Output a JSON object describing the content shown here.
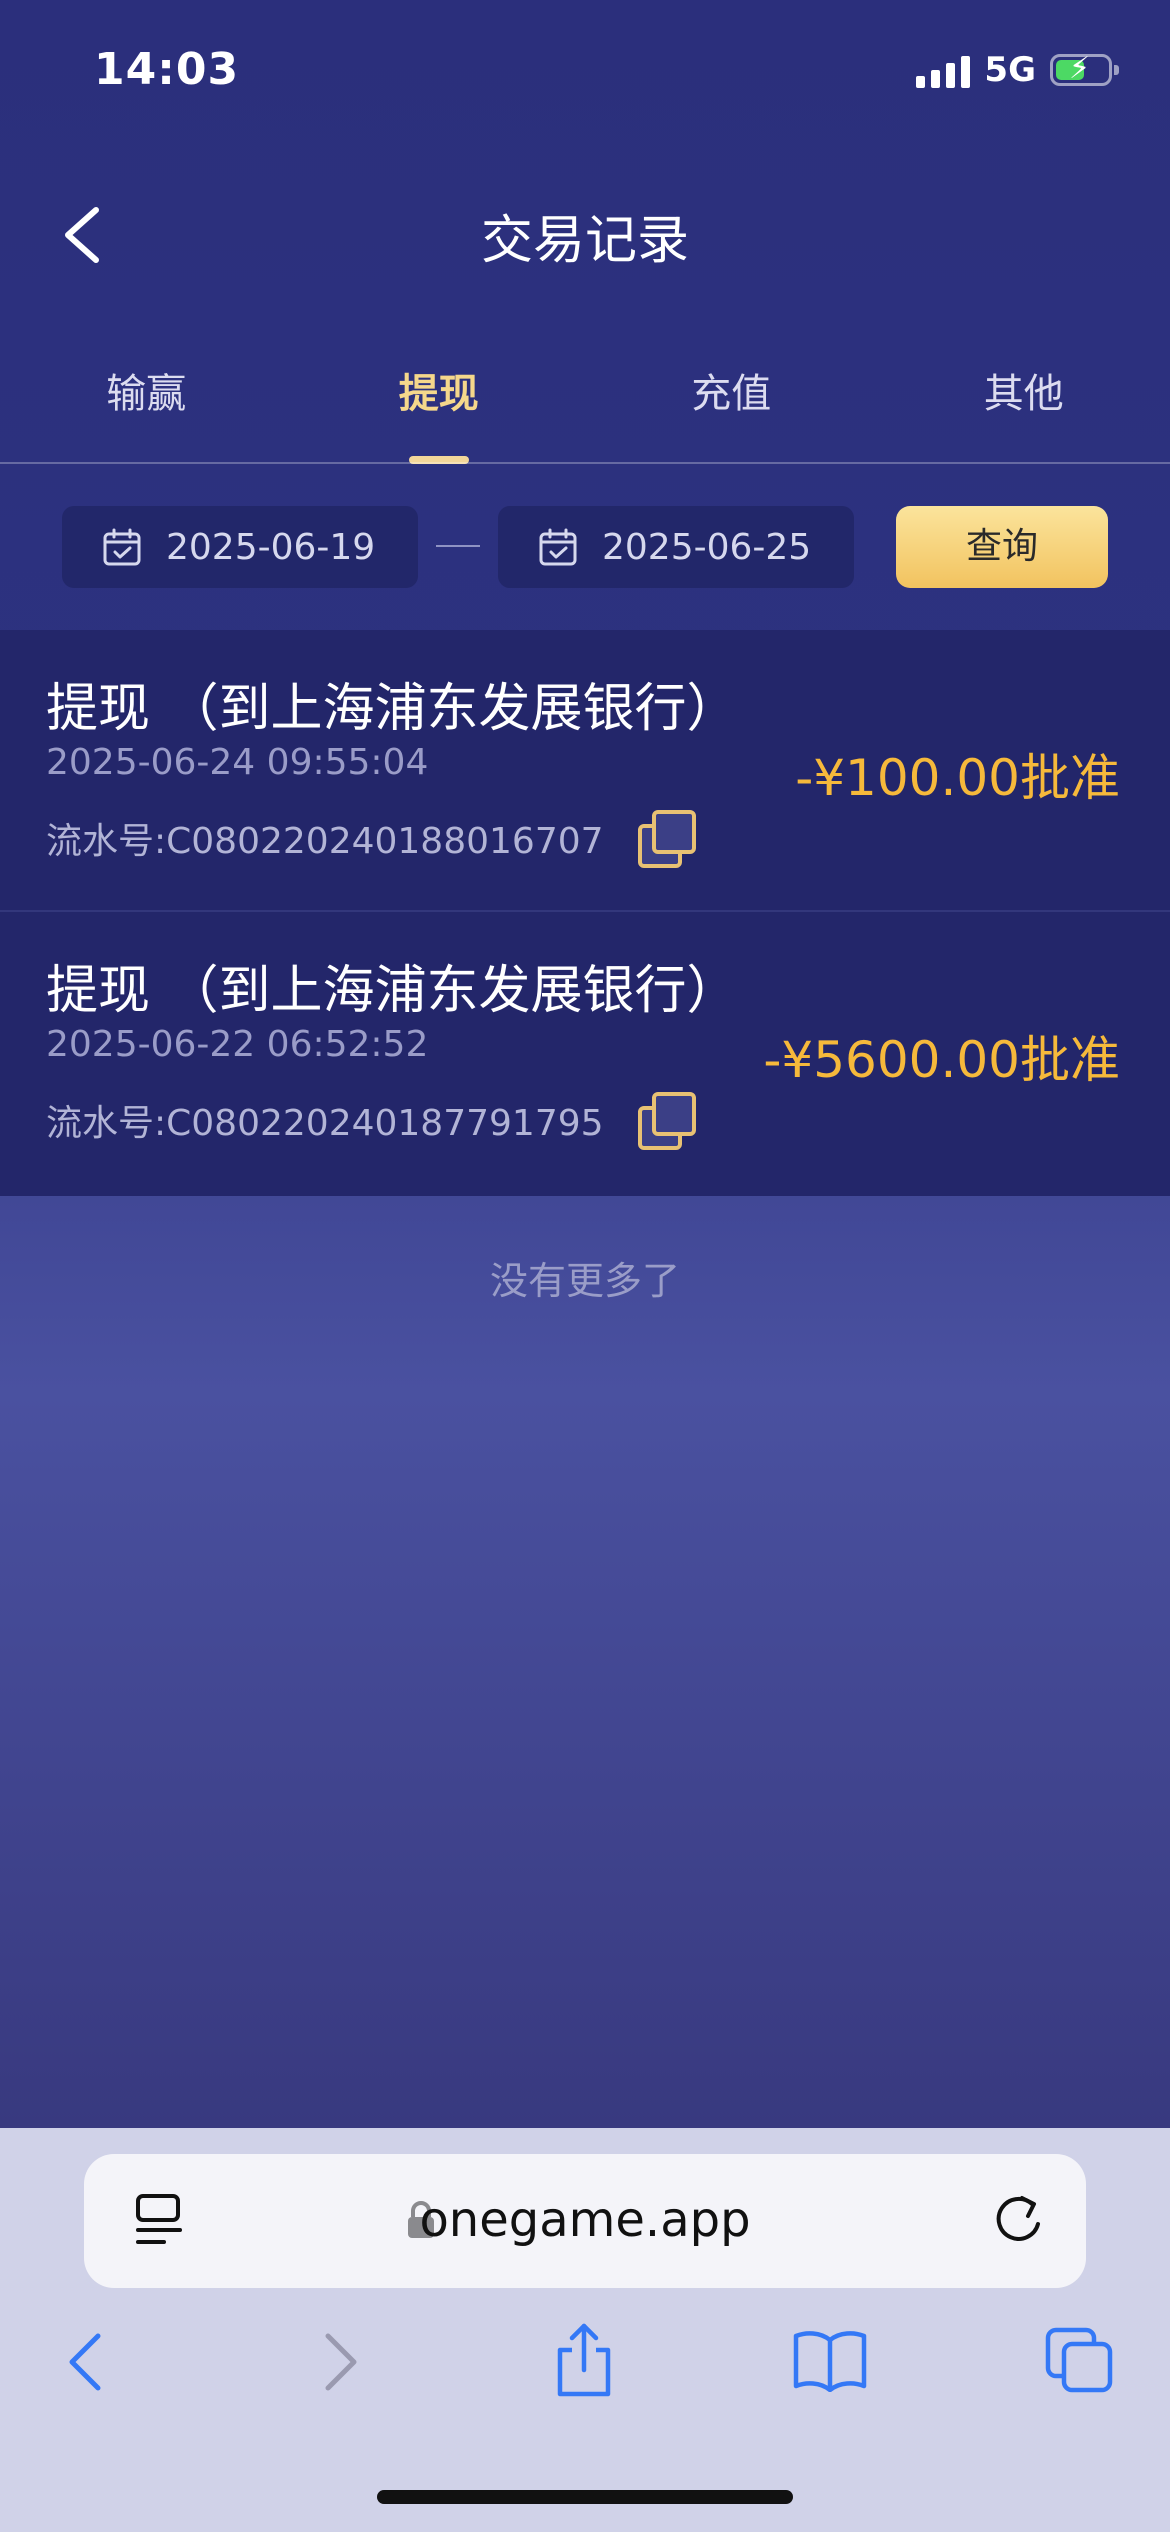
{
  "status": {
    "time": "14:03",
    "network": "5G"
  },
  "header": {
    "title": "交易记录"
  },
  "tabs": [
    {
      "label": "输赢",
      "active": false
    },
    {
      "label": "提现",
      "active": true
    },
    {
      "label": "充值",
      "active": false
    },
    {
      "label": "其他",
      "active": false
    }
  ],
  "filter": {
    "start_date": "2025-06-19",
    "end_date": "2025-06-25",
    "query_label": "查询"
  },
  "records": [
    {
      "title": "提现 （到上海浦东发展银行）",
      "time": "2025-06-24 09:55:04",
      "serial": "流水号:C080220240188016707",
      "amount": "-¥100.00批准"
    },
    {
      "title": "提现 （到上海浦东发展银行）",
      "time": "2025-06-22 06:52:52",
      "serial": "流水号:C080220240187791795",
      "amount": "-¥5600.00批准"
    }
  ],
  "footer_text": "没有更多了",
  "browser": {
    "url": "onegame.app"
  },
  "colors": {
    "accent": "#f6b93b",
    "tab_active": "#f5d78b",
    "background": "#2d3280",
    "row_bg": "#23266a",
    "browser_bar": "#d0d2e8",
    "browser_icon": "#3478f6"
  }
}
